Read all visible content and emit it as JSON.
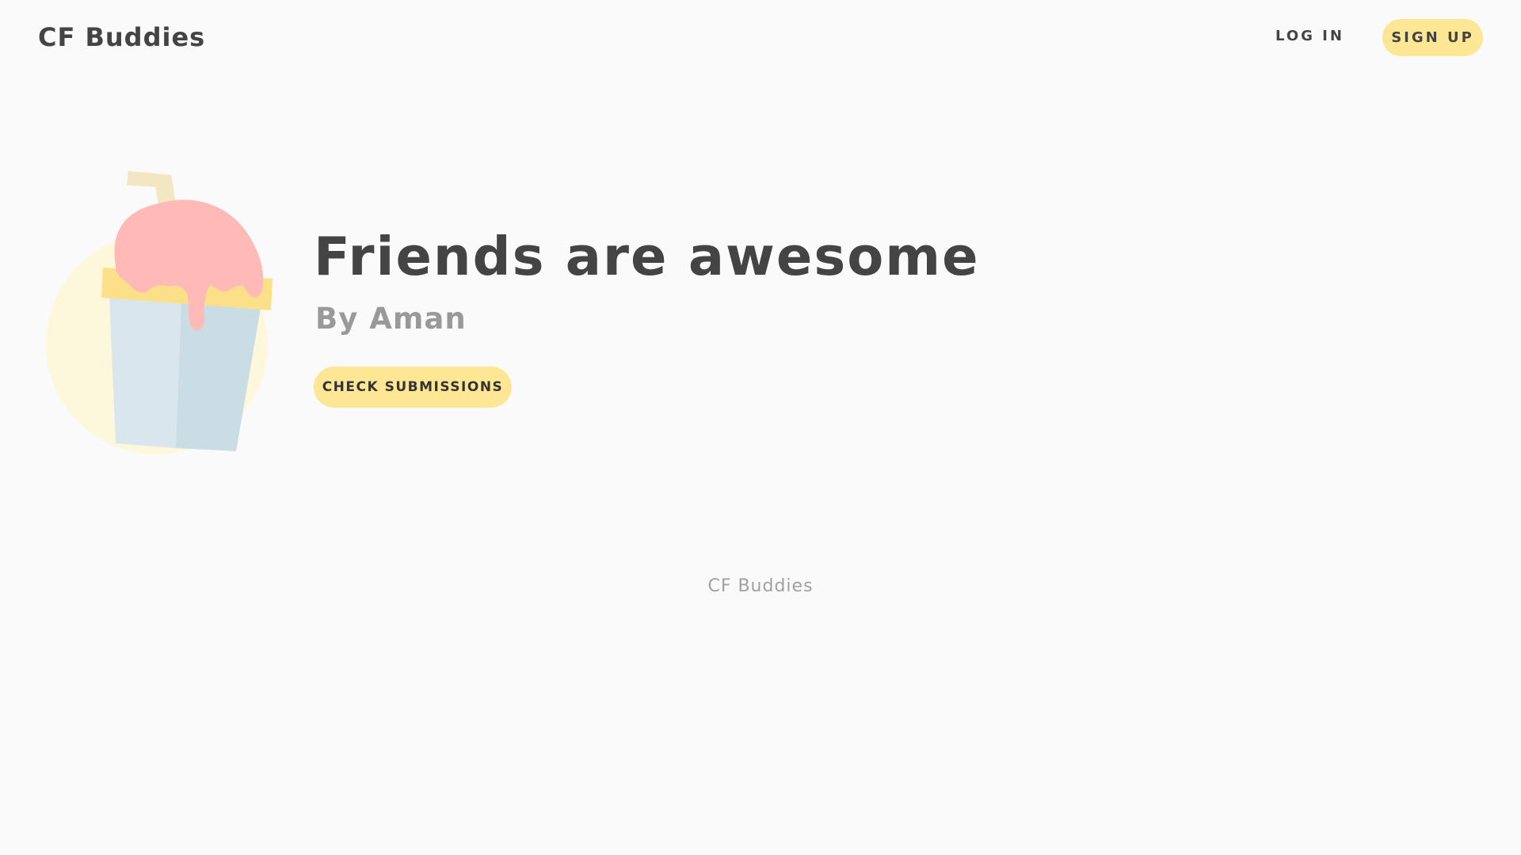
{
  "header": {
    "brand": "CF Buddies",
    "login_label": "LOG IN",
    "signup_label": "SIGN UP"
  },
  "hero": {
    "illustration": "milkshake-illustration",
    "title": "Friends are awesome",
    "subtitle": "By Aman",
    "cta_label": "CHECK SUBMISSIONS"
  },
  "footer": {
    "text": "CF Buddies"
  },
  "colors": {
    "background": "#fafafa",
    "accent": "#fde694",
    "text_dark": "#444444",
    "text_muted": "#999999",
    "illustration_pink": "#ffb9b7",
    "illustration_cup": "#d9e6ed",
    "illustration_circle": "#fdf7dc"
  }
}
